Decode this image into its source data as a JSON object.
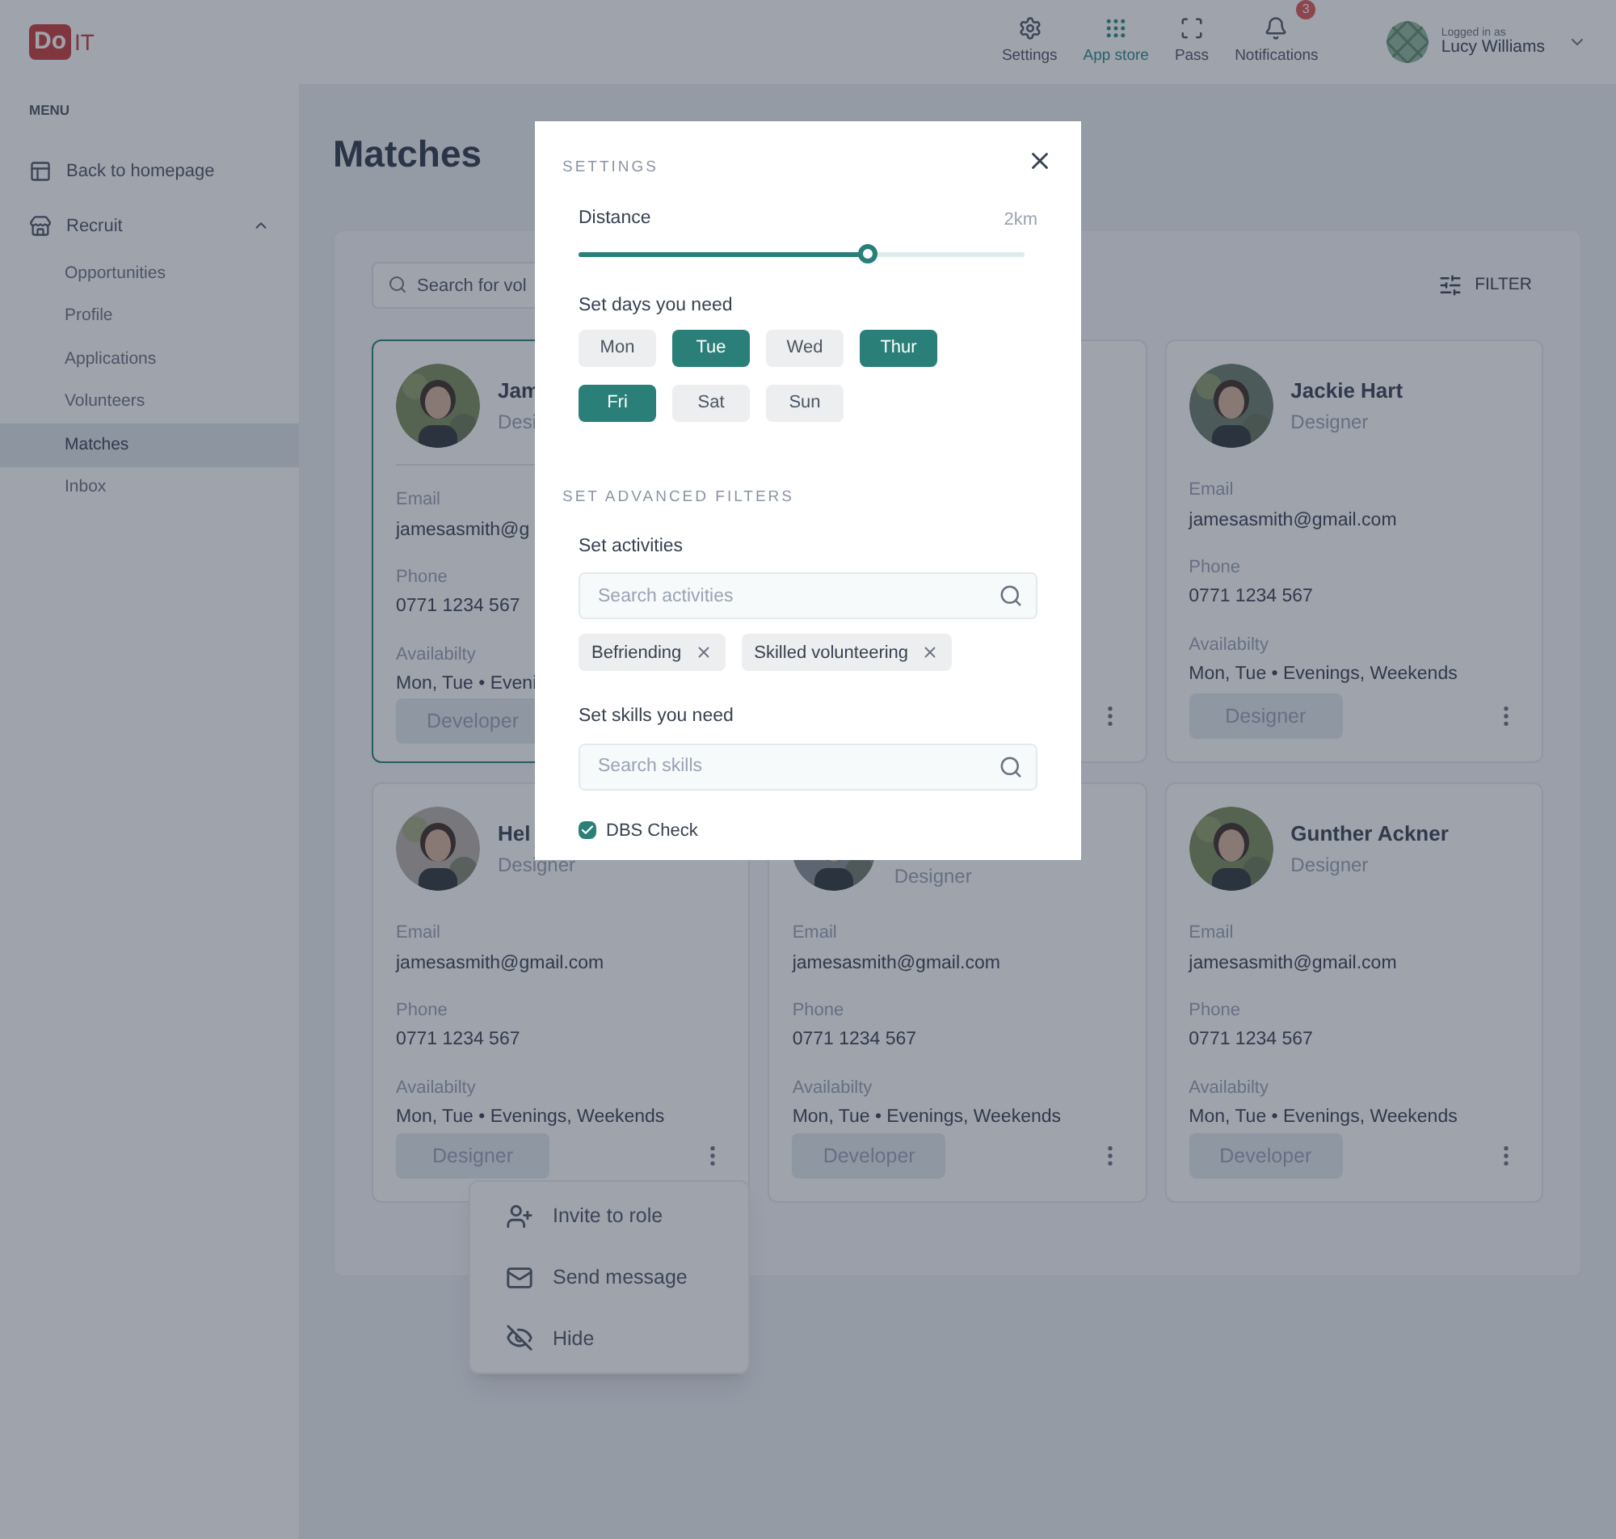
{
  "header": {
    "logo": {
      "mark": "Do",
      "text": "IT"
    },
    "nav": [
      {
        "label": "Settings",
        "selected": false
      },
      {
        "label": "App store",
        "selected": true
      },
      {
        "label": "Pass",
        "selected": false
      },
      {
        "label": "Notifications",
        "selected": false,
        "badge": "3"
      }
    ],
    "user": {
      "caption": "Logged in as",
      "name": "Lucy Williams"
    }
  },
  "sidebar": {
    "heading": "MENU",
    "items": [
      {
        "label": "Back to homepage",
        "kind": "link",
        "selected": false
      },
      {
        "label": "Recruit",
        "kind": "group",
        "selected": false,
        "expanded": true,
        "children": [
          {
            "label": "Opportunities",
            "selected": false
          },
          {
            "label": "Profile",
            "selected": false
          },
          {
            "label": "Applications",
            "selected": false
          },
          {
            "label": "Volunteers",
            "selected": false
          },
          {
            "label": "Matches",
            "selected": true
          },
          {
            "label": "Inbox",
            "selected": false
          }
        ]
      }
    ]
  },
  "page": {
    "title": "Matches",
    "search": {
      "placeholder": "Search for vol"
    },
    "filter_button": "FILTER",
    "cards": [
      {
        "selected": true,
        "avatar": true,
        "name": "Jam",
        "role": "Desi",
        "fields": [
          {
            "label": "Email",
            "value": "jamesasmith@g"
          },
          {
            "label": "Phone",
            "value": "0771 1234 567"
          },
          {
            "label": "Availabilty",
            "value": "Mon, Tue • Eveni"
          }
        ],
        "tag": "Developer",
        "more": false
      },
      {
        "selected": false,
        "avatar": false,
        "more": true
      },
      {
        "selected": false,
        "avatar": true,
        "name": "Jackie Hart",
        "role": "Designer",
        "fields": [
          {
            "label": "Email",
            "value": "jamesasmith@gmail.com"
          },
          {
            "label": "Phone",
            "value": "0771 1234 567"
          },
          {
            "label": "Availabilty",
            "value": "Mon, Tue • Evenings, Weekends"
          }
        ],
        "tag": "Designer",
        "more": true
      },
      {
        "selected": false,
        "avatar": true,
        "name": "Hel",
        "role": "Designer",
        "fields": [
          {
            "label": "Email",
            "value": "jamesasmith@gmail.com"
          },
          {
            "label": "Phone",
            "value": "0771 1234 567"
          },
          {
            "label": "Availabilty",
            "value": "Mon, Tue • Evenings, Weekends"
          }
        ],
        "tag": "Designer",
        "more": true
      },
      {
        "selected": false,
        "avatar": true,
        "role": "Designer",
        "fields": [
          {
            "label": "Email",
            "value": "jamesasmith@gmail.com"
          },
          {
            "label": "Phone",
            "value": "0771 1234 567"
          },
          {
            "label": "Availabilty",
            "value": "Mon, Tue • Evenings, Weekends"
          }
        ],
        "tag": "Developer",
        "more": true
      },
      {
        "selected": false,
        "avatar": true,
        "name": "Gunther Ackner",
        "role": "Designer",
        "fields": [
          {
            "label": "Email",
            "value": "jamesasmith@gmail.com"
          },
          {
            "label": "Phone",
            "value": "0771 1234 567"
          },
          {
            "label": "Availabilty",
            "value": "Mon, Tue • Evenings, Weekends"
          }
        ],
        "tag": "Developer",
        "more": true
      }
    ],
    "context_menu": {
      "items": [
        {
          "label": "Invite to role",
          "kind": "invite"
        },
        {
          "label": "Send message",
          "kind": "message"
        },
        {
          "label": "Hide",
          "kind": "hide"
        }
      ]
    }
  },
  "modal": {
    "title": "SETTINGS",
    "distance": {
      "label": "Distance",
      "reading": "2km",
      "level": 0.65
    },
    "days_label": "Set days you need",
    "days": [
      {
        "label": "Mon",
        "selected": false
      },
      {
        "label": "Tue",
        "selected": true
      },
      {
        "label": "Wed",
        "selected": false
      },
      {
        "label": "Thur",
        "selected": true
      },
      {
        "label": "Fri",
        "selected": true
      },
      {
        "label": "Sat",
        "selected": false
      },
      {
        "label": "Sun",
        "selected": false
      }
    ],
    "advanced_title": "SET ADVANCED FILTERS",
    "activities": {
      "label": "Set activities",
      "placeholder": "Search activities",
      "chips": [
        "Befriending",
        "Skilled volunteering"
      ]
    },
    "skills": {
      "label": "Set skills you need",
      "placeholder": "Search skills"
    },
    "dbs": {
      "label": "DBS Check",
      "checked": true
    }
  }
}
